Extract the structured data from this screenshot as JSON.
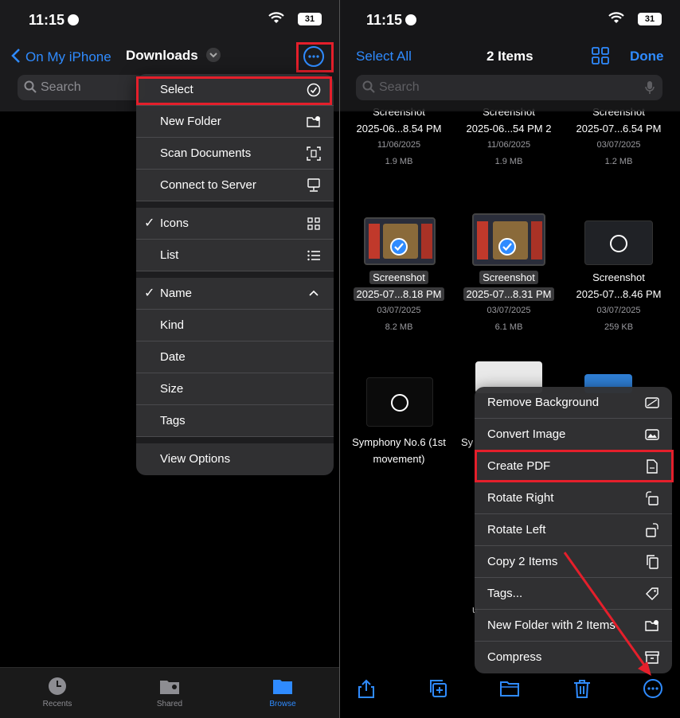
{
  "status": {
    "time": "11:15",
    "battery": "31"
  },
  "left": {
    "nav": {
      "back_label": "On My iPhone",
      "title": "Downloads"
    },
    "search": {
      "placeholder": "Search"
    },
    "menu": {
      "actions": [
        {
          "label": "Select",
          "icon": "checkmark-circle-icon"
        },
        {
          "label": "New Folder",
          "icon": "folder-plus-icon"
        },
        {
          "label": "Scan Documents",
          "icon": "scan-document-icon"
        },
        {
          "label": "Connect to Server",
          "icon": "server-display-icon"
        }
      ],
      "view": [
        {
          "label": "Icons",
          "checked": true,
          "icon": "grid-icon"
        },
        {
          "label": "List",
          "checked": false,
          "icon": "list-icon"
        }
      ],
      "sort": [
        {
          "label": "Name",
          "checked": true,
          "icon": "chevron-up-icon"
        },
        {
          "label": "Kind",
          "checked": false
        },
        {
          "label": "Date",
          "checked": false
        },
        {
          "label": "Size",
          "checked": false
        },
        {
          "label": "Tags",
          "checked": false
        }
      ],
      "options": [
        {
          "label": "View Options"
        }
      ],
      "check_glyph": "✓"
    },
    "tabs": [
      {
        "label": "Recents",
        "icon": "clock-icon"
      },
      {
        "label": "Shared",
        "icon": "shared-folder-icon"
      },
      {
        "label": "Browse",
        "icon": "folder-icon",
        "active": true
      }
    ]
  },
  "right": {
    "nav": {
      "select_all": "Select All",
      "count": "2 Items",
      "done": "Done"
    },
    "search": {
      "placeholder": "Search"
    },
    "files_row1": [
      {
        "name1": "Screenshot",
        "name2": "2025-06...8.54 PM",
        "date": "11/06/2025",
        "size": "1.9 MB"
      },
      {
        "name1": "Screenshot",
        "name2": "2025-06...54 PM 2",
        "date": "11/06/2025",
        "size": "1.9 MB"
      },
      {
        "name1": "Screenshot",
        "name2": "2025-07...6.54 PM",
        "date": "03/07/2025",
        "size": "1.2 MB"
      }
    ],
    "files_row2": [
      {
        "name1": "Screenshot",
        "name2": "2025-07...8.18 PM",
        "date": "03/07/2025",
        "size": "8.2 MB",
        "selected": true
      },
      {
        "name1": "Screenshot",
        "name2": "2025-07...8.31 PM",
        "date": "03/07/2025",
        "size": "6.1 MB",
        "selected": true
      },
      {
        "name1": "Screenshot",
        "name2": "2025-07...8.46 PM",
        "date": "03/07/2025",
        "size": "259 KB",
        "selected": false
      }
    ],
    "files_row3": [
      {
        "name1": "Symphony No.6 (1st",
        "name2": "movement)"
      },
      {
        "name1": "Sy"
      }
    ],
    "hidden_fragment": "u",
    "menu": [
      {
        "label": "Remove Background",
        "icon": "remove-background-icon"
      },
      {
        "label": "Convert Image",
        "icon": "photo-convert-icon"
      },
      {
        "label": "Create PDF",
        "icon": "pdf-document-icon"
      },
      {
        "label": "Rotate Right",
        "icon": "rotate-right-icon"
      },
      {
        "label": "Rotate Left",
        "icon": "rotate-left-icon"
      },
      {
        "label": "Copy 2 Items",
        "icon": "copy-icon"
      },
      {
        "label": "Tags...",
        "icon": "tag-icon"
      },
      {
        "label": "New Folder with 2 Items",
        "icon": "folder-plus-icon"
      },
      {
        "label": "Compress",
        "icon": "archive-box-icon"
      }
    ],
    "toolbar": [
      "share-icon",
      "duplicate-icon",
      "move-folder-icon",
      "trash-icon",
      "more-icon"
    ]
  },
  "colors": {
    "accent": "#2f8bff",
    "highlight": "#e41f2b",
    "menu_bg": "#323234"
  }
}
